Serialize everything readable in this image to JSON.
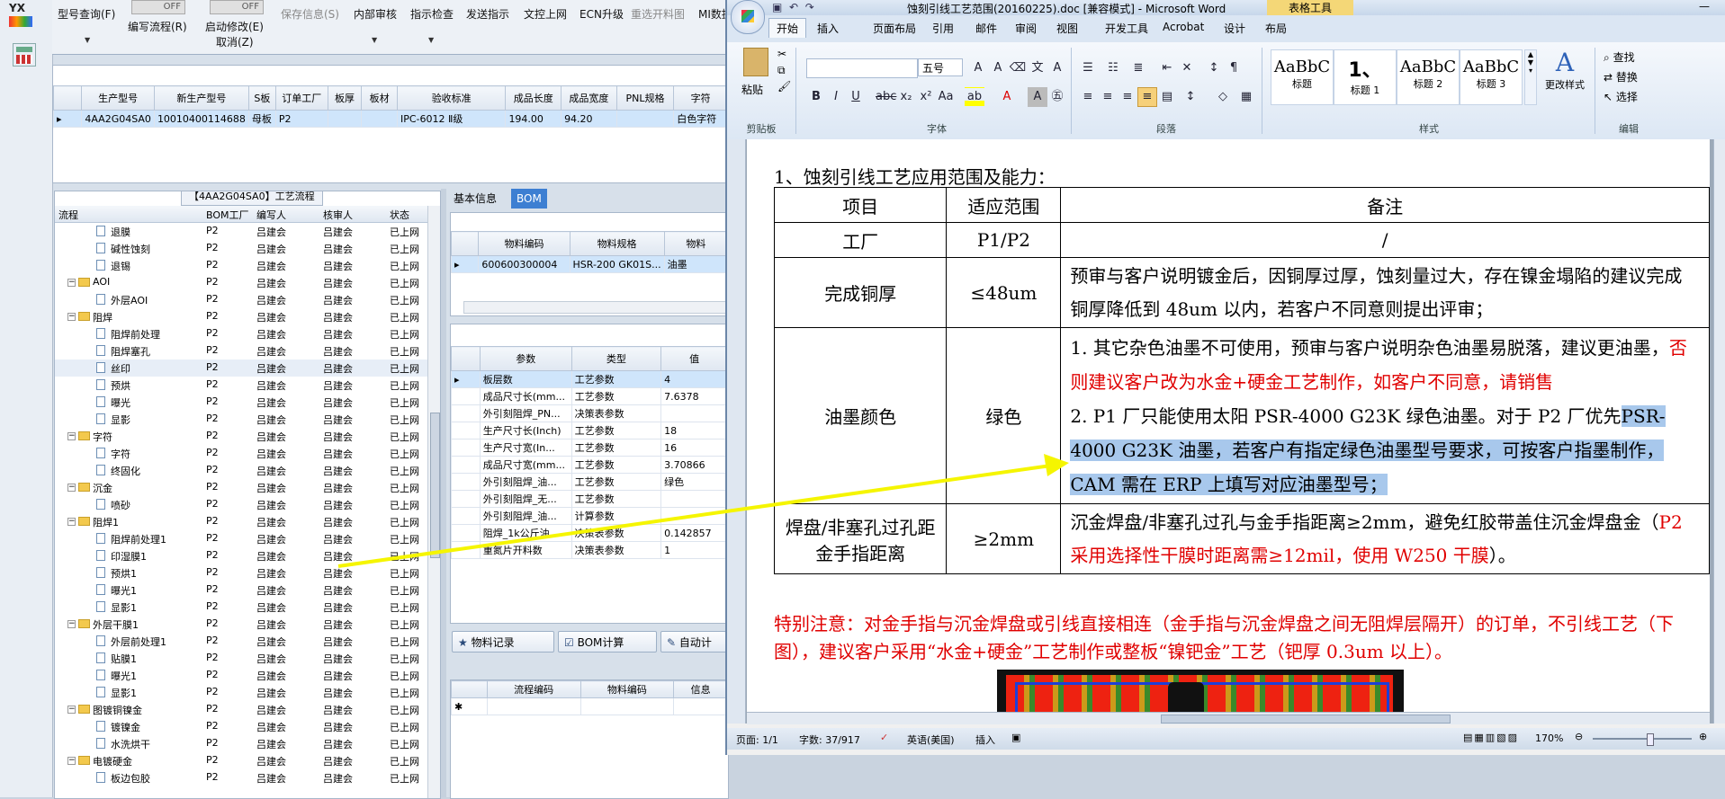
{
  "erp": {
    "side_logo": "YX",
    "toolbar": {
      "items": [
        {
          "label": "型号查询(F)",
          "disabled": false
        },
        {
          "label": "编写流程(R)",
          "disabled": false
        },
        {
          "label": "启动修改(E)",
          "disabled": false
        },
        {
          "label": "取消(Z)",
          "disabled": false
        },
        {
          "label": "保存信息(S)",
          "disabled": true
        },
        {
          "label": "内部审核",
          "disabled": false
        },
        {
          "label": "指示检查",
          "disabled": false
        },
        {
          "label": "发送指示",
          "disabled": false
        },
        {
          "label": "文控上网",
          "disabled": false
        },
        {
          "label": "ECN升级",
          "disabled": false
        },
        {
          "label": "重选开料图",
          "disabled": true
        },
        {
          "label": "MI数据",
          "disabled": false
        }
      ],
      "toggle1": "OFF",
      "toggle2": "OFF"
    },
    "top_grid": {
      "headers": [
        "生产型号",
        "新生产型号",
        "S板",
        "订单工厂",
        "板厚",
        "板材",
        "验收标准",
        "成品长度",
        "成品宽度",
        "PNL规格",
        "字符"
      ],
      "row": [
        "4AA2G04SA0",
        "10010400114688",
        "母板",
        "P2",
        "",
        "",
        "IPC-6012 Ⅱ级",
        "194.00",
        "94.20",
        "",
        "白色字符"
      ]
    },
    "process": {
      "title": "【4AA2G04SA0】工艺流程",
      "headers": [
        "流程",
        "BOM工厂",
        "编写人",
        "核审人",
        "状态"
      ],
      "rows": [
        {
          "level": 2,
          "type": "doc",
          "name": "退膜",
          "factory": "P2",
          "writer": "吕建会",
          "reviewer": "吕建会",
          "status": "已上网"
        },
        {
          "level": 2,
          "type": "doc",
          "name": "碱性蚀刻",
          "factory": "P2",
          "writer": "吕建会",
          "reviewer": "吕建会",
          "status": "已上网"
        },
        {
          "level": 2,
          "type": "doc",
          "name": "退锡",
          "factory": "P2",
          "writer": "吕建会",
          "reviewer": "吕建会",
          "status": "已上网"
        },
        {
          "level": 1,
          "type": "folder",
          "name": "AOI",
          "factory": "P2",
          "writer": "吕建会",
          "reviewer": "吕建会",
          "status": "已上网"
        },
        {
          "level": 2,
          "type": "doc",
          "name": "外层AOI",
          "factory": "P2",
          "writer": "吕建会",
          "reviewer": "吕建会",
          "status": "已上网"
        },
        {
          "level": 1,
          "type": "folder",
          "name": "阻焊",
          "factory": "P2",
          "writer": "吕建会",
          "reviewer": "吕建会",
          "status": "已上网"
        },
        {
          "level": 2,
          "type": "doc",
          "name": "阻焊前处理",
          "factory": "P2",
          "writer": "吕建会",
          "reviewer": "吕建会",
          "status": "已上网"
        },
        {
          "level": 2,
          "type": "doc",
          "name": "阻焊塞孔",
          "factory": "P2",
          "writer": "吕建会",
          "reviewer": "吕建会",
          "status": "已上网"
        },
        {
          "level": 2,
          "type": "doc",
          "name": "丝印",
          "factory": "P2",
          "writer": "吕建会",
          "reviewer": "吕建会",
          "status": "已上网"
        },
        {
          "level": 2,
          "type": "doc",
          "name": "预烘",
          "factory": "P2",
          "writer": "吕建会",
          "reviewer": "吕建会",
          "status": "已上网"
        },
        {
          "level": 2,
          "type": "doc",
          "name": "曝光",
          "factory": "P2",
          "writer": "吕建会",
          "reviewer": "吕建会",
          "status": "已上网"
        },
        {
          "level": 2,
          "type": "doc",
          "name": "显影",
          "factory": "P2",
          "writer": "吕建会",
          "reviewer": "吕建会",
          "status": "已上网"
        },
        {
          "level": 1,
          "type": "folder",
          "name": "字符",
          "factory": "P2",
          "writer": "吕建会",
          "reviewer": "吕建会",
          "status": "已上网"
        },
        {
          "level": 2,
          "type": "doc",
          "name": "字符",
          "factory": "P2",
          "writer": "吕建会",
          "reviewer": "吕建会",
          "status": "已上网"
        },
        {
          "level": 2,
          "type": "doc",
          "name": "终固化",
          "factory": "P2",
          "writer": "吕建会",
          "reviewer": "吕建会",
          "status": "已上网"
        },
        {
          "level": 1,
          "type": "folder",
          "name": "沉金",
          "factory": "P2",
          "writer": "吕建会",
          "reviewer": "吕建会",
          "status": "已上网"
        },
        {
          "level": 2,
          "type": "doc",
          "name": "喷砂",
          "factory": "P2",
          "writer": "吕建会",
          "reviewer": "吕建会",
          "status": "已上网"
        },
        {
          "level": 1,
          "type": "folder",
          "name": "阻焊1",
          "factory": "P2",
          "writer": "吕建会",
          "reviewer": "吕建会",
          "status": "已上网"
        },
        {
          "level": 2,
          "type": "doc",
          "name": "阻焊前处理1",
          "factory": "P2",
          "writer": "吕建会",
          "reviewer": "吕建会",
          "status": "已上网"
        },
        {
          "level": 2,
          "type": "doc",
          "name": "印湿膜1",
          "factory": "P2",
          "writer": "吕建会",
          "reviewer": "吕建会",
          "status": "已上网"
        },
        {
          "level": 2,
          "type": "doc",
          "name": "预烘1",
          "factory": "P2",
          "writer": "吕建会",
          "reviewer": "吕建会",
          "status": "已上网"
        },
        {
          "level": 2,
          "type": "doc",
          "name": "曝光1",
          "factory": "P2",
          "writer": "吕建会",
          "reviewer": "吕建会",
          "status": "已上网"
        },
        {
          "level": 2,
          "type": "doc",
          "name": "显影1",
          "factory": "P2",
          "writer": "吕建会",
          "reviewer": "吕建会",
          "status": "已上网"
        },
        {
          "level": 1,
          "type": "folder",
          "name": "外层干膜1",
          "factory": "P2",
          "writer": "吕建会",
          "reviewer": "吕建会",
          "status": "已上网"
        },
        {
          "level": 2,
          "type": "doc",
          "name": "外层前处理1",
          "factory": "P2",
          "writer": "吕建会",
          "reviewer": "吕建会",
          "status": "已上网"
        },
        {
          "level": 2,
          "type": "doc",
          "name": "贴膜1",
          "factory": "P2",
          "writer": "吕建会",
          "reviewer": "吕建会",
          "status": "已上网"
        },
        {
          "level": 2,
          "type": "doc",
          "name": "曝光1",
          "factory": "P2",
          "writer": "吕建会",
          "reviewer": "吕建会",
          "status": "已上网"
        },
        {
          "level": 2,
          "type": "doc",
          "name": "显影1",
          "factory": "P2",
          "writer": "吕建会",
          "reviewer": "吕建会",
          "status": "已上网"
        },
        {
          "level": 1,
          "type": "folder",
          "name": "图镀铜镍金",
          "factory": "P2",
          "writer": "吕建会",
          "reviewer": "吕建会",
          "status": "已上网"
        },
        {
          "level": 2,
          "type": "doc",
          "name": "镀镍金",
          "factory": "P2",
          "writer": "吕建会",
          "reviewer": "吕建会",
          "status": "已上网"
        },
        {
          "level": 2,
          "type": "doc",
          "name": "水洗烘干",
          "factory": "P2",
          "writer": "吕建会",
          "reviewer": "吕建会",
          "status": "已上网"
        },
        {
          "level": 1,
          "type": "folder",
          "name": "电镀硬金",
          "factory": "P2",
          "writer": "吕建会",
          "reviewer": "吕建会",
          "status": "已上网"
        },
        {
          "level": 2,
          "type": "doc",
          "name": "板边包胶",
          "factory": "P2",
          "writer": "吕建会",
          "reviewer": "吕建会",
          "status": "已上网"
        }
      ]
    },
    "tabs": [
      "基本信息",
      "BOM"
    ],
    "bom": {
      "headers": [
        "物料编码",
        "物料规格",
        "物料"
      ],
      "row": [
        "600600300004",
        "HSR-200 GK01S...",
        "油墨"
      ]
    },
    "params": {
      "headers": [
        "参数",
        "类型",
        "值"
      ],
      "rows": [
        [
          "板层数",
          "工艺参数",
          "4"
        ],
        [
          "成品尺寸长(mm...",
          "工艺参数",
          "7.6378"
        ],
        [
          "外引刻阻焊_PN...",
          "决策表参数",
          ""
        ],
        [
          "生产尺寸长(Inch)",
          "工艺参数",
          "18"
        ],
        [
          "生产尺寸宽(In...",
          "工艺参数",
          "16"
        ],
        [
          "成品尺寸宽(mm...",
          "工艺参数",
          "3.70866"
        ],
        [
          "外引刻阻焊_油...",
          "工艺参数",
          "绿色"
        ],
        [
          "外引刻阻焊_无...",
          "工艺参数",
          ""
        ],
        [
          "外引刻阻焊_油...",
          "计算参数",
          ""
        ],
        [
          "阻焊_1k公斤油...",
          "决策表参数",
          "0.142857"
        ],
        [
          "重氮片开料数",
          "决策表参数",
          "1"
        ]
      ]
    },
    "buttons": [
      "物料记录",
      "BOM计算",
      "自动计"
    ],
    "bottom_grid": {
      "headers": [
        "流程编码",
        "物料编码",
        "信息"
      ],
      "new_row_marker": "✱"
    }
  },
  "word": {
    "title": "蚀刻引线工艺范围(20160225).doc [兼容模式] - Microsoft Word",
    "context_tab": "表格工具",
    "tabs": [
      "开始",
      "插入",
      "页面布局",
      "引用",
      "邮件",
      "审阅",
      "视图",
      "开发工具",
      "Acrobat",
      "设计",
      "布局"
    ],
    "ribbon": {
      "paste": "粘贴",
      "clipboard": "剪贴板",
      "font_size": "五号",
      "font_group": "字体",
      "paragraph_group": "段落",
      "styles_group": "样式",
      "edit_group": "编辑",
      "styles": [
        {
          "preview": "AaBbC",
          "name": "标题"
        },
        {
          "preview": "1、",
          "name": "标题 1"
        },
        {
          "preview": "AaBbC",
          "name": "标题 2"
        },
        {
          "preview": "AaBbC",
          "name": "标题 3"
        }
      ],
      "change_styles": "更改样式",
      "find": "查找",
      "replace": "替换",
      "select": "选择"
    },
    "doc": {
      "heading": "1、蚀刻引线工艺应用范围及能力：",
      "table_headers": [
        "项目",
        "适应范围",
        "备注"
      ],
      "rows": [
        {
          "item": "工厂",
          "range": "P1/P2",
          "note": "/"
        },
        {
          "item": "完成铜厚",
          "range": "≤48um",
          "note": "预审与客户说明镀金后，因铜厚过厚，蚀刻量过大，存在镍金塌陷的建议完成铜厚降低到 48um 以内，若客户不同意则提出评审；"
        },
        {
          "item": "油墨颜色",
          "range": "绿色",
          "note1": "1. 其它杂色油墨不可使用，预审与客户说明杂色油墨易脱落，建议更油墨，",
          "note1_red": "否则建议客户改为水金+硬金工艺制作，如客户不同意，请销售",
          "note2": "2. P1 厂只能使用太阳 PSR-4000 G23K 绿色油墨。对于 P2 厂优先",
          "note2_hl": "PSR-4000 G23K 油墨，若客户有指定绿色油墨型号要求，可按客户指墨制作，CAM 需在 ERP 上填写对应油墨型号；"
        },
        {
          "item": "焊盘/非塞孔过孔距金手指距离",
          "range": "≥2mm",
          "note": "沉金焊盘/非塞孔过孔与金手指距离≥2mm，避免红胶带盖住沉金焊盘金（",
          "note_red": "P2 采用选择性干膜时距离需≥12mil，使用 W250 干膜",
          "note_end": "）。"
        }
      ],
      "special_note": "特别注意：对金手指与沉金焊盘或引线直接相连（金手指与沉金焊盘之间无阻焊层隔开）的订单，不引线工艺（下图），建议客户采用“水金+硬金”工艺制作或整板“镍钯金”工艺（钯厚 0.3um 以上）。"
    },
    "status": {
      "page": "页面: 1/1",
      "words": "字数: 37/917",
      "lang": "英语(美国)",
      "mode": "插入",
      "zoom": "170%"
    }
  }
}
